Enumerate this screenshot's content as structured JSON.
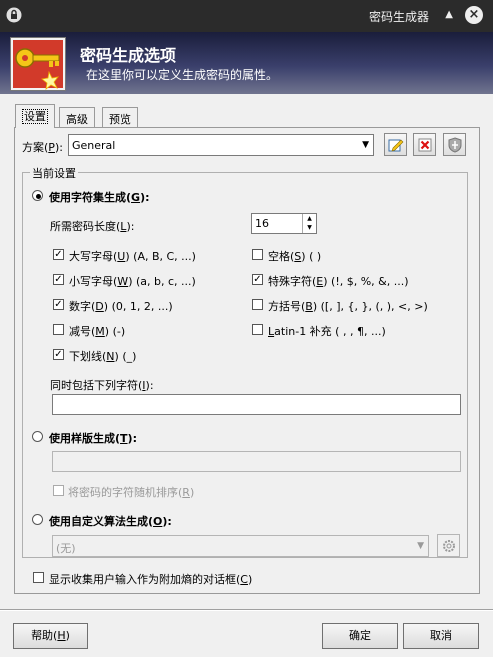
{
  "window": {
    "title": "密码生成器"
  },
  "banner": {
    "title": "密码生成选项",
    "subtitle": "在这里你可以定义生成密码的属性。"
  },
  "tabs": [
    {
      "label": "设置"
    },
    {
      "label": "高级"
    },
    {
      "label": "预览"
    }
  ],
  "scheme": {
    "label": "方案(",
    "key": "P",
    "label_end": "):",
    "value": "General"
  },
  "current": {
    "legend": "当前设置",
    "charset": {
      "label": "使用字符集生成(",
      "key": "G",
      "label_end": "):",
      "length_label": "所需密码长度(",
      "length_key": "L",
      "length_end": "):",
      "length_value": "16",
      "options": [
        {
          "text": "大写字母(",
          "key": "U",
          "rest": ") (A, B, C, ...)",
          "checked": true
        },
        {
          "text": "空格(",
          "key": "S",
          "rest": ") ( )",
          "checked": false
        },
        {
          "text": "小写字母(",
          "key": "W",
          "rest": ") (a, b, c, ...)",
          "checked": true
        },
        {
          "text": "特殊字符(",
          "key": "E",
          "rest": ") (!, $, %, &, ...)",
          "checked": true
        },
        {
          "text": "数字(",
          "key": "D",
          "rest": ") (0, 1, 2, ...)",
          "checked": true
        },
        {
          "text": "方括号(",
          "key": "B",
          "rest": ") ([, ], {, }, (, ), <, >)",
          "checked": false
        },
        {
          "text": "减号(",
          "key": "M",
          "rest": ") (-)",
          "checked": false
        },
        {
          "text": "",
          "key": "L",
          "rest": "atin-1 补充 ( , , ¶, ...)",
          "checked": false
        },
        {
          "text": "下划线(",
          "key": "N",
          "rest": ") (_)",
          "checked": true
        }
      ],
      "include_label": "同时包括下列字符(",
      "include_key": "I",
      "include_end": "):",
      "include_value": ""
    },
    "pattern": {
      "label": "使用样版生成(",
      "key": "T",
      "label_end": "):",
      "value": "",
      "shuffle_label": "将密码的字符随机排序(",
      "shuffle_key": "R",
      "shuffle_end": ")"
    },
    "custom": {
      "label": "使用自定义算法生成(",
      "key": "O",
      "label_end": "):",
      "value": "(无)"
    },
    "dialog_label": "显示收集用户输入作为附加熵的对话框(",
    "dialog_key": "C",
    "dialog_end": ")"
  },
  "buttons": {
    "help": "帮助(",
    "help_key": "H",
    "help_end": ")",
    "ok": "确定",
    "cancel": "取消"
  },
  "colors": {
    "titlebar": "#2b2b2b",
    "banner_dark": "#1a1d3b",
    "banner_light": "#70748f"
  }
}
